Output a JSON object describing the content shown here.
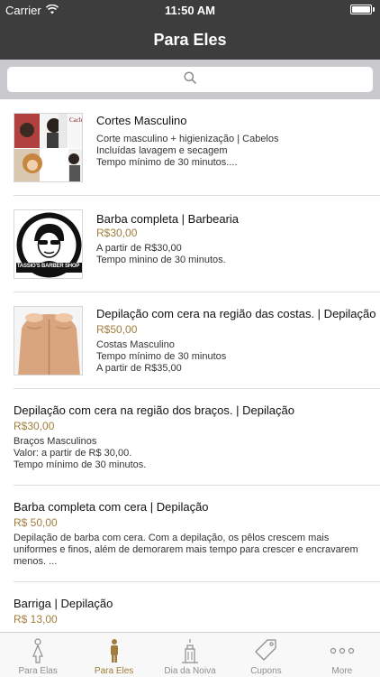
{
  "status": {
    "carrier": "Carrier",
    "time": "11:50 AM",
    "battery_level": 1.0
  },
  "nav": {
    "title": "Para Eles"
  },
  "search": {
    "placeholder": "",
    "icon": "search-icon"
  },
  "items": [
    {
      "title": "Cortes Masculino",
      "price": "",
      "description": "Corte masculino + higienização | Cabelos\nIncluídas lavagem e secagem\nTempo mínimo de 30 minutos....",
      "thumb": "haircut-collage",
      "thumb_text": "Cach"
    },
    {
      "title": "Barba completa | Barbearia",
      "price": "R$30,00",
      "description": "A partir de R$30,00\nTempo minino de 30 minutos.",
      "thumb": "barber-shop-logo",
      "thumb_text": "TASSIO'S BARBER SHOP"
    },
    {
      "title": "Depilação com cera na região das costas. | Depilação",
      "price": "R$50,00",
      "description": "Costas Masculino\nTempo mínimo de 30 minutos\nA partir de R$35,00",
      "thumb": "back-photo",
      "thumb_text": ""
    },
    {
      "title": "Depilação com cera na região dos braços. | Depilação",
      "price": "R$30,00",
      "description": "Braços Masculinos\n Valor: a partir de R$ 30,00.\nTempo mínimo de 30 minutos.",
      "thumb": "",
      "thumb_text": ""
    },
    {
      "title": "Barba completa com cera | Depilação",
      "price": "R$ 50,00",
      "description": "Depilação de barba com cera. Com a depilação, os pêlos crescem mais\nuniformes e finos, além de demorarem mais tempo para crescer e encravarem\nmenos. ...",
      "thumb": "",
      "thumb_text": ""
    },
    {
      "title": "Barriga | Depilação",
      "price": "R$ 13,00",
      "description": "",
      "thumb": "",
      "thumb_text": ""
    }
  ],
  "tabs": [
    {
      "label": "Para Elas",
      "icon": "female-figure-icon",
      "active": false
    },
    {
      "label": "Para Eles",
      "icon": "male-figure-icon",
      "active": true
    },
    {
      "label": "Dia da Noiva",
      "icon": "building-icon",
      "active": false
    },
    {
      "label": "Cupons",
      "icon": "tag-icon",
      "active": false
    },
    {
      "label": "More",
      "icon": "more-dots-icon",
      "active": false
    }
  ],
  "colors": {
    "nav_bar": "#3d3d3d",
    "accent": "#a07d3c",
    "search_bg": "#c9c9ce",
    "tab_inactive": "#8e8e93"
  }
}
